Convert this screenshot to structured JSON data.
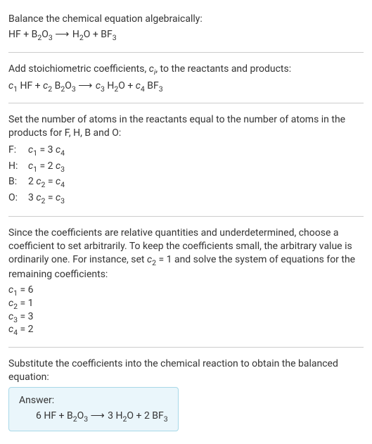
{
  "intro": {
    "line1": "Balance the chemical equation algebraically:",
    "equation_html": "HF + B<sub>2</sub>O<sub>3</sub>  <span class='arrow'>⟶</span>  H<sub>2</sub>O + BF<sub>3</sub>"
  },
  "add_coeffs": {
    "text_html": "Add stoichiometric coefficients, <span class='italic'>c<sub>i</sub></span>, to the reactants and products:",
    "equation_html": "<span class='italic'>c</span><sub>1</sub> HF + <span class='italic'>c</span><sub>2</sub> B<sub>2</sub>O<sub>3</sub>  <span class='arrow'>⟶</span>  <span class='italic'>c</span><sub>3</sub> H<sub>2</sub>O + <span class='italic'>c</span><sub>4</sub> BF<sub>3</sub>"
  },
  "set_atoms": {
    "text": "Set the number of atoms in the reactants equal to the number of atoms in the products for F, H, B and O:",
    "rows": [
      {
        "label": "F:",
        "eq_html": "<span class='italic'>c</span><sub>1</sub> = 3 <span class='italic'>c</span><sub>4</sub>"
      },
      {
        "label": "H:",
        "eq_html": "<span class='italic'>c</span><sub>1</sub> = 2 <span class='italic'>c</span><sub>3</sub>"
      },
      {
        "label": "B:",
        "eq_html": "2 <span class='italic'>c</span><sub>2</sub> = <span class='italic'>c</span><sub>4</sub>"
      },
      {
        "label": "O:",
        "eq_html": "3 <span class='italic'>c</span><sub>2</sub> = <span class='italic'>c</span><sub>3</sub>"
      }
    ]
  },
  "solve": {
    "text_html": "Since the coefficients are relative quantities and underdetermined, choose a coefficient to set arbitrarily. To keep the coefficients small, the arbitrary value is ordinarily one. For instance, set <span class='italic'>c</span><sub>2</sub> = 1 and solve the system of equations for the remaining coefficients:",
    "lines": [
      "<span class='italic'>c</span><sub>1</sub> = 6",
      "<span class='italic'>c</span><sub>2</sub> = 1",
      "<span class='italic'>c</span><sub>3</sub> = 3",
      "<span class='italic'>c</span><sub>4</sub> = 2"
    ]
  },
  "substitute": {
    "text": "Substitute the coefficients into the chemical reaction to obtain the balanced equation:"
  },
  "answer": {
    "label": "Answer:",
    "equation_html": "6 HF + B<sub>2</sub>O<sub>3</sub>  <span class='arrow'>⟶</span>  3 H<sub>2</sub>O + 2 BF<sub>3</sub>"
  }
}
